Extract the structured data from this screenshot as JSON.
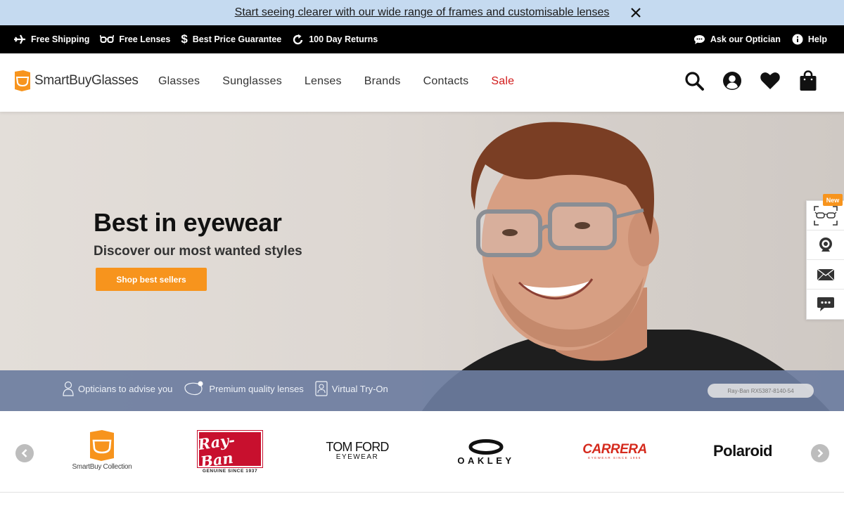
{
  "promo": {
    "text": "Start seeing clearer with our wide range of frames and customisable lenses"
  },
  "utility": {
    "left": [
      {
        "icon": "plane-icon",
        "label": "Free Shipping"
      },
      {
        "icon": "glasses-icon",
        "label": "Free Lenses"
      },
      {
        "icon": "dollar-icon",
        "label": "Best Price Guarantee"
      },
      {
        "icon": "return-icon",
        "label": "100 Day Returns"
      }
    ],
    "right": [
      {
        "icon": "chat-icon",
        "label": "Ask our Optician"
      },
      {
        "icon": "info-icon",
        "label": "Help"
      }
    ]
  },
  "header": {
    "logo": "SmartBuyGlasses",
    "nav": [
      "Glasses",
      "Sunglasses",
      "Lenses",
      "Brands",
      "Contacts",
      "Sale"
    ]
  },
  "hero": {
    "title": "Best in eyewear",
    "subtitle": "Discover our most wanted styles",
    "cta": "Shop best sellers",
    "features": [
      "Opticians to advise you",
      "Premium quality lenses",
      "Virtual Try-On"
    ],
    "product_tag": "Ray-Ban RX5387-8140-54"
  },
  "side_widget": {
    "badge": "New"
  },
  "brands": {
    "smartbuy": {
      "label": "SmartBuy Collection"
    },
    "rayban": {
      "name": "Ray-Ban",
      "tagline": "GENUINE SINCE 1937"
    },
    "tomford": {
      "name": "TOM FORD",
      "sub": "EYEWEAR"
    },
    "oakley": {
      "name": "OAKLEY"
    },
    "carrera": {
      "name": "CARRERA",
      "sub": "EYEWEAR SINCE 1956"
    },
    "polaroid": {
      "name": "Polaroid"
    }
  },
  "colors": {
    "accent": "#f7941d",
    "sale": "#d11a1a",
    "promo_bg": "#c5daf0",
    "feature_bar": "#6c7da0"
  }
}
